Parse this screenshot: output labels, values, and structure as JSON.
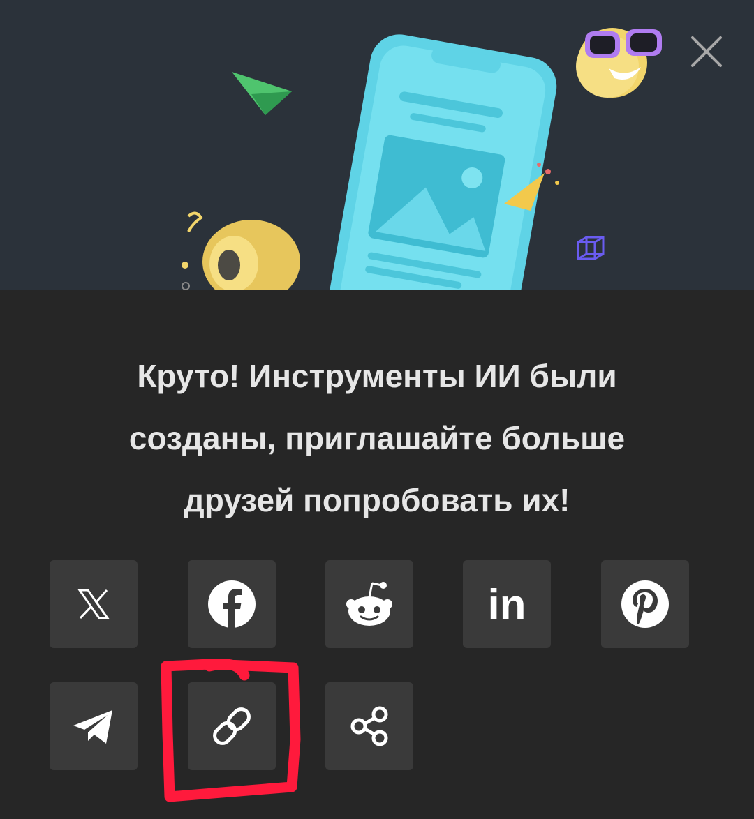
{
  "dialog": {
    "message_lines": [
      "Круто! Инструменты ИИ были",
      "созданы, приглашайте больше",
      "друзей попробовать их!"
    ]
  },
  "share_buttons": [
    {
      "id": "x",
      "icon": "x-logo-icon"
    },
    {
      "id": "facebook",
      "icon": "facebook-icon"
    },
    {
      "id": "reddit",
      "icon": "reddit-icon"
    },
    {
      "id": "linkedin",
      "icon": "linkedin-icon",
      "glyph": "in"
    },
    {
      "id": "pinterest",
      "icon": "pinterest-icon"
    },
    {
      "id": "telegram",
      "icon": "telegram-icon"
    },
    {
      "id": "copy-link",
      "icon": "link-icon",
      "highlighted": true
    },
    {
      "id": "share",
      "icon": "share-icon"
    }
  ],
  "colors": {
    "hero_background": "#2b323a",
    "panel_background": "#262626",
    "tile_background": "#3a3a3a",
    "text": "#e6e6e6",
    "highlight": "#ff1a3c"
  }
}
